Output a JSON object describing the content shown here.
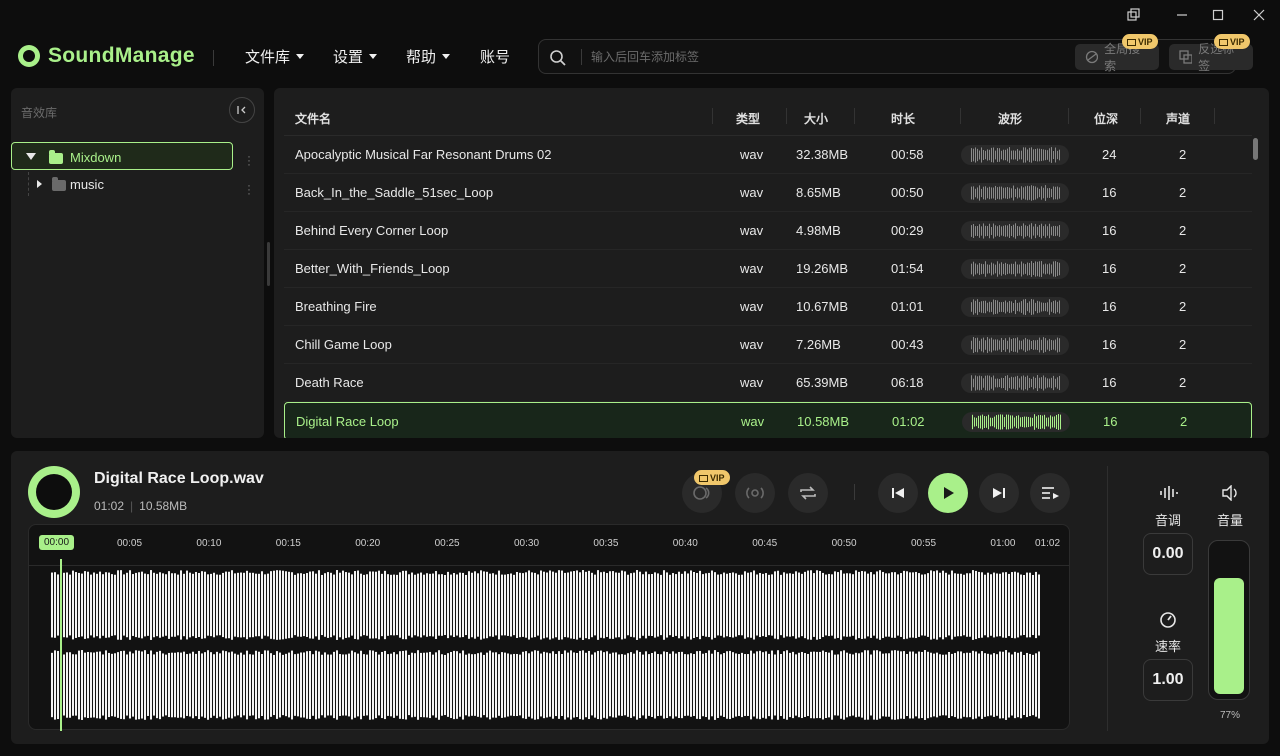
{
  "app": {
    "name": "SoundManage",
    "accent": "#a9f08a",
    "vip_color": "#f0c76b",
    "window_buttons": [
      "restore-window",
      "minimize",
      "maximize",
      "close"
    ]
  },
  "menu": [
    {
      "label": "文件库",
      "dropdown": true
    },
    {
      "label": "设置",
      "dropdown": true
    },
    {
      "label": "帮助",
      "dropdown": true
    },
    {
      "label": "账号",
      "dropdown": false
    }
  ],
  "search": {
    "placeholder": "输入后回车添加标签",
    "global_search": "全局搜索",
    "invert_tags": "反选标签",
    "vip_badge": "VIP"
  },
  "sidebar": {
    "title": "音效库",
    "tree": [
      {
        "label": "Mixdown",
        "expanded": true,
        "selected": true
      },
      {
        "label": "music",
        "expanded": false,
        "selected": false
      }
    ]
  },
  "table": {
    "headers": [
      "文件名",
      "类型",
      "大小",
      "时长",
      "波形",
      "位深",
      "声道"
    ],
    "rows": [
      {
        "name": "Apocalyptic Musical Far Resonant Drums 02",
        "type": "wav",
        "size": "32.38MB",
        "duration": "00:58",
        "bits": "24",
        "channels": "2"
      },
      {
        "name": "Back_In_the_Saddle_51sec_Loop",
        "type": "wav",
        "size": "8.65MB",
        "duration": "00:50",
        "bits": "16",
        "channels": "2"
      },
      {
        "name": "Behind Every Corner Loop",
        "type": "wav",
        "size": "4.98MB",
        "duration": "00:29",
        "bits": "16",
        "channels": "2"
      },
      {
        "name": "Better_With_Friends_Loop",
        "type": "wav",
        "size": "19.26MB",
        "duration": "01:54",
        "bits": "16",
        "channels": "2"
      },
      {
        "name": "Breathing Fire",
        "type": "wav",
        "size": "10.67MB",
        "duration": "01:01",
        "bits": "16",
        "channels": "2"
      },
      {
        "name": "Chill Game Loop",
        "type": "wav",
        "size": "7.26MB",
        "duration": "00:43",
        "bits": "16",
        "channels": "2"
      },
      {
        "name": "Death Race",
        "type": "wav",
        "size": "65.39MB",
        "duration": "06:18",
        "bits": "16",
        "channels": "2"
      },
      {
        "name": "Digital Race Loop",
        "type": "wav",
        "size": "10.58MB",
        "duration": "01:02",
        "bits": "16",
        "channels": "2",
        "selected": true
      }
    ]
  },
  "player": {
    "title": "Digital Race Loop.wav",
    "duration": "01:02",
    "separator": "|",
    "size": "10.58MB",
    "vip_badge": "VIP",
    "current_time": "00:00",
    "timeline": [
      "00:05",
      "00:10",
      "00:15",
      "00:20",
      "00:25",
      "00:30",
      "00:35",
      "00:40",
      "00:45",
      "00:50",
      "00:55",
      "01:00",
      "01:02"
    ],
    "progress": 0.0
  },
  "controls": {
    "pitch_label": "音调",
    "pitch_value": "0.00",
    "rate_label": "速率",
    "rate_value": "1.00",
    "volume_label": "音量",
    "volume_percent": "77%",
    "volume_level": 0.77
  }
}
